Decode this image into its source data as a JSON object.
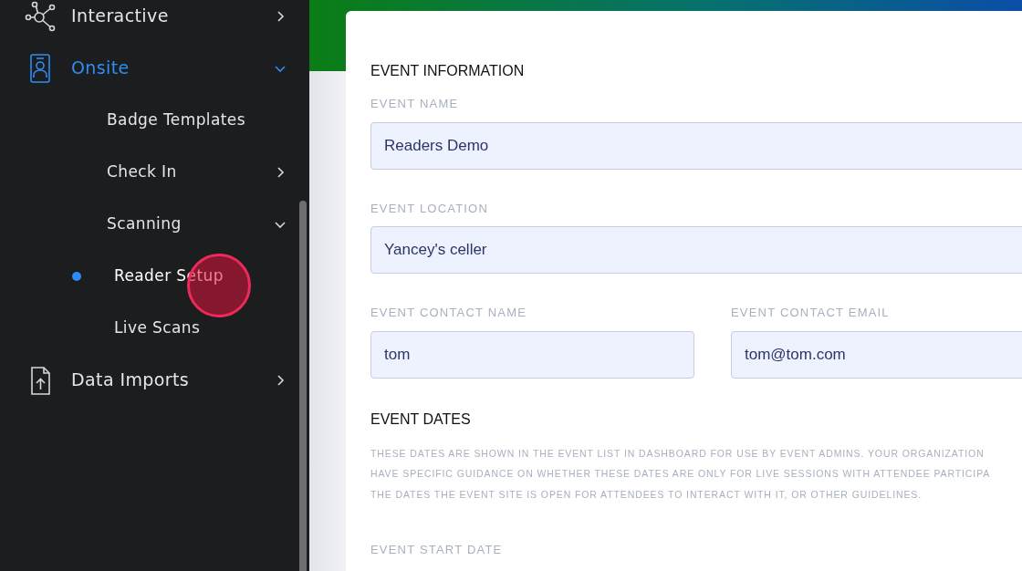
{
  "sidebar": {
    "items": [
      {
        "label": "Interactive",
        "selected": false,
        "expanded": false
      },
      {
        "label": "Onsite",
        "selected": true,
        "expanded": true,
        "children": [
          {
            "label": "Badge Templates",
            "selected": false
          },
          {
            "label": "Check In",
            "selected": false,
            "expanded": false
          },
          {
            "label": "Scanning",
            "selected": false,
            "expanded": true,
            "children": [
              {
                "label": "Reader Setup",
                "selected": true
              },
              {
                "label": "Live Scans",
                "selected": false
              }
            ]
          }
        ]
      },
      {
        "label": "Data Imports",
        "selected": false,
        "expanded": false
      }
    ]
  },
  "form": {
    "sections": [
      {
        "title": "EVENT INFORMATION",
        "rows": [
          [
            {
              "label": "EVENT NAME",
              "value": "Readers Demo"
            }
          ],
          [
            {
              "label": "EVENT LOCATION",
              "value": "Yancey's celler"
            }
          ],
          [
            {
              "label": "EVENT CONTACT NAME",
              "value": "tom"
            },
            {
              "label": "EVENT CONTACT EMAIL",
              "value": "tom@tom.com"
            }
          ]
        ]
      },
      {
        "title": "EVENT DATES",
        "description": [
          "THESE DATES ARE SHOWN IN THE EVENT LIST IN DASHBOARD FOR USE BY EVENT ADMINS. YOUR ORGANIZATION",
          "HAVE SPECIFIC GUIDANCE ON WHETHER THESE DATES ARE ONLY FOR LIVE SESSIONS WITH ATTENDEE PARTICIPA",
          "THE DATES THE EVENT SITE IS OPEN FOR ATTENDEES TO INTERACT WITH IT, OR OTHER GUIDELINES."
        ],
        "rows": [
          [
            {
              "label": "EVENT START DATE"
            }
          ]
        ]
      }
    ]
  }
}
